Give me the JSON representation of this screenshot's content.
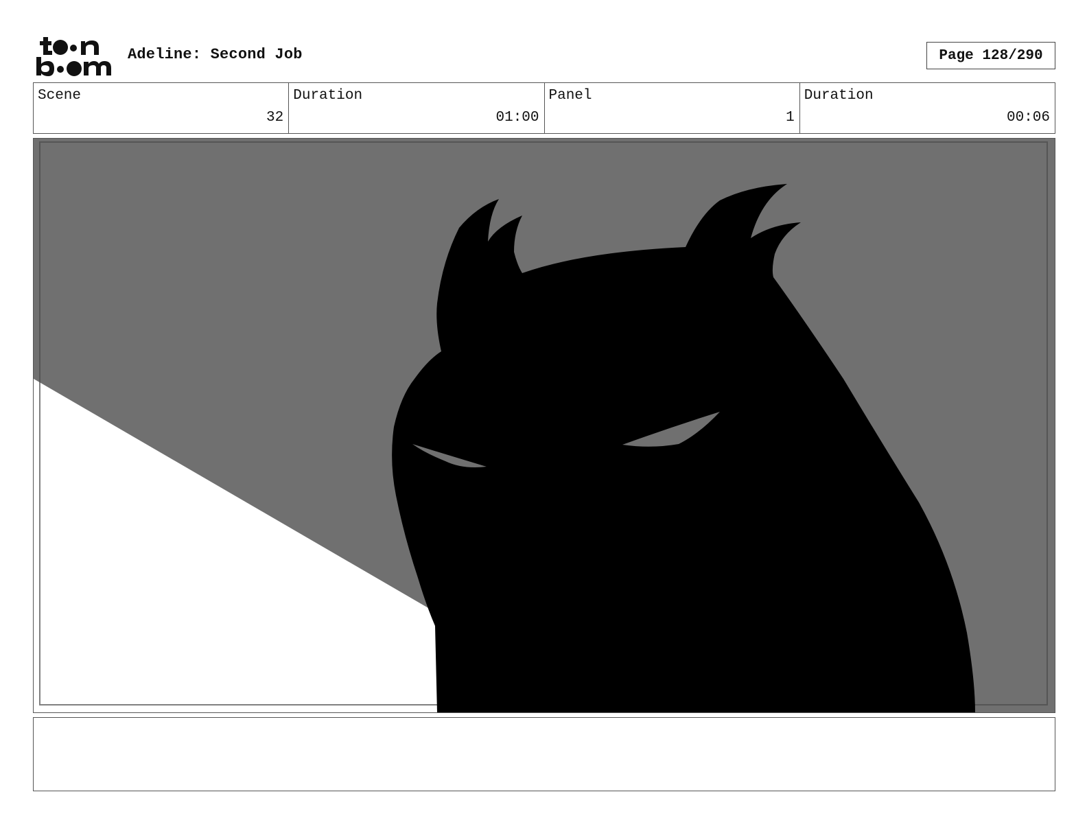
{
  "header": {
    "logo_text": "toon boom",
    "title": "Adeline: Second Job",
    "page_label": "Page 128/290"
  },
  "info": {
    "scene_label": "Scene",
    "scene_value": "32",
    "scene_duration_label": "Duration",
    "scene_duration_value": "01:00",
    "panel_label": "Panel",
    "panel_value": "1",
    "panel_duration_label": "Duration",
    "panel_duration_value": "00:06"
  },
  "panel": {
    "background_color": "#707070",
    "light_color": "#ffffff",
    "silhouette_color": "#000000",
    "eye_color": "#707070"
  },
  "notes": {
    "text": ""
  }
}
